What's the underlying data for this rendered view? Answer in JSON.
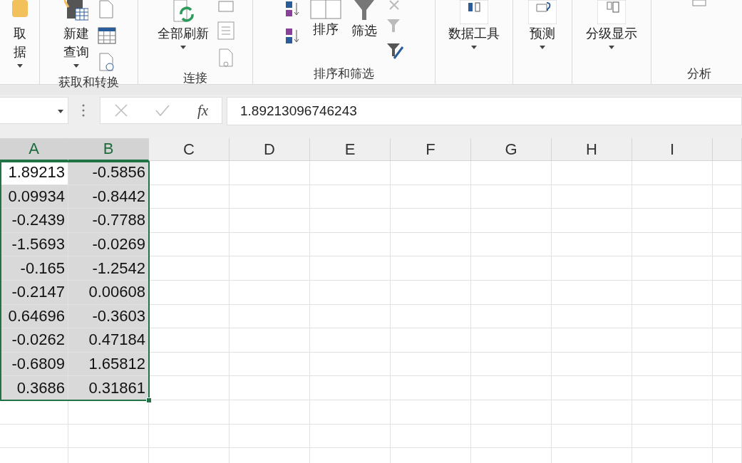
{
  "ribbon": {
    "groups": [
      {
        "buttons": [
          {
            "lines": [
              "取",
              "据"
            ],
            "dropdown": true
          }
        ]
      },
      {
        "label": "获取和转换",
        "buttons": [
          {
            "lines": [
              "新建",
              "查询"
            ],
            "dropdown": true
          }
        ]
      },
      {
        "label": "连接",
        "buttons": [
          {
            "lines": [
              "全部刷新"
            ],
            "dropdown": true
          }
        ]
      },
      {
        "label": "排序和筛选",
        "buttons": [
          {
            "lines": [
              "排序"
            ],
            "dropdown": false
          },
          {
            "lines": [
              "筛选"
            ],
            "dropdown": false
          }
        ]
      },
      {
        "buttons": [
          {
            "lines": [
              "数据工具"
            ],
            "dropdown": true
          }
        ]
      },
      {
        "buttons": [
          {
            "lines": [
              "预测"
            ],
            "dropdown": true
          }
        ]
      },
      {
        "buttons": [
          {
            "lines": [
              "分级显示"
            ],
            "dropdown": true
          }
        ]
      },
      {
        "label": "分析"
      }
    ]
  },
  "formula_bar": {
    "function_label": "fx",
    "value": "1.89213096746243"
  },
  "sheet": {
    "columns": [
      {
        "label": "A",
        "selected": true
      },
      {
        "label": "B",
        "selected": true
      },
      {
        "label": "C",
        "selected": false
      },
      {
        "label": "D",
        "selected": false
      },
      {
        "label": "E",
        "selected": false
      },
      {
        "label": "F",
        "selected": false
      },
      {
        "label": "G",
        "selected": false
      },
      {
        "label": "H",
        "selected": false
      },
      {
        "label": "I",
        "selected": false
      }
    ],
    "rows": [
      {
        "selected": true,
        "cells": [
          {
            "value": "1.89213",
            "active": true
          },
          {
            "value": "-0.5856",
            "active": false
          }
        ]
      },
      {
        "selected": true,
        "cells": [
          {
            "value": "0.09934",
            "active": false
          },
          {
            "value": "-0.8442",
            "active": false
          }
        ]
      },
      {
        "selected": true,
        "cells": [
          {
            "value": "-0.2439",
            "active": false
          },
          {
            "value": "-0.7788",
            "active": false
          }
        ]
      },
      {
        "selected": true,
        "cells": [
          {
            "value": "-1.5693",
            "active": false
          },
          {
            "value": "-0.0269",
            "active": false
          }
        ]
      },
      {
        "selected": true,
        "cells": [
          {
            "value": "-0.165",
            "active": false
          },
          {
            "value": "-1.2542",
            "active": false
          }
        ]
      },
      {
        "selected": true,
        "cells": [
          {
            "value": "-0.2147",
            "active": false
          },
          {
            "value": "0.00608",
            "active": false
          }
        ]
      },
      {
        "selected": true,
        "cells": [
          {
            "value": "0.64696",
            "active": false
          },
          {
            "value": "-0.3603",
            "active": false
          }
        ]
      },
      {
        "selected": true,
        "cells": [
          {
            "value": "-0.0262",
            "active": false
          },
          {
            "value": "0.47184",
            "active": false
          }
        ]
      },
      {
        "selected": true,
        "cells": [
          {
            "value": "-0.6809",
            "active": false
          },
          {
            "value": "1.65812",
            "active": false
          }
        ]
      },
      {
        "selected": true,
        "cells": [
          {
            "value": "0.3686",
            "active": false
          },
          {
            "value": "0.31861",
            "active": false
          }
        ]
      }
    ]
  }
}
